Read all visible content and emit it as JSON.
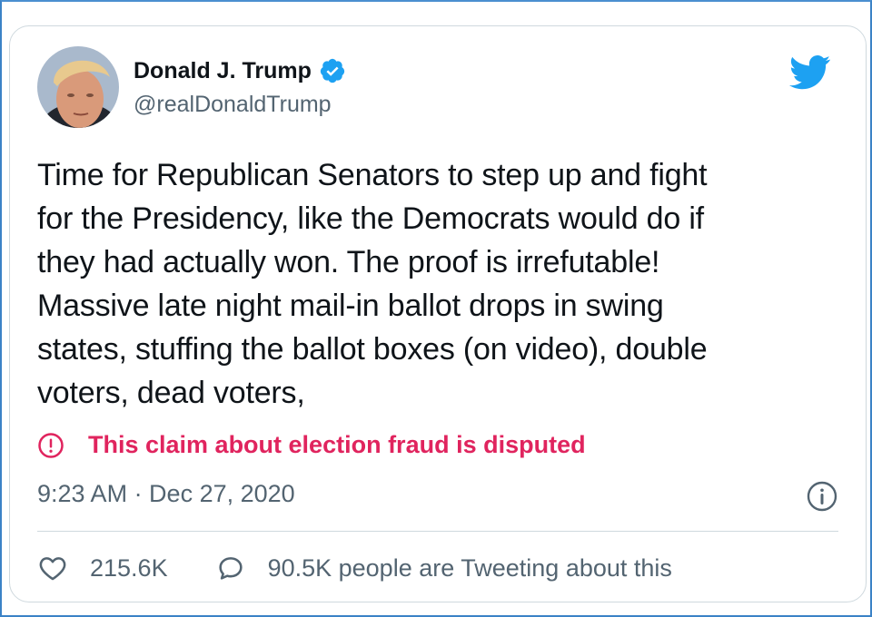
{
  "tweet": {
    "author": {
      "name": "Donald J. Trump",
      "handle": "@realDonaldTrump",
      "verified": true
    },
    "text": "Time for Republican Senators to step up and fight\nfor the Presidency, like the Democrats would do if\nthey had actually won. The proof is irrefutable!\nMassive late night mail-in ballot drops in swing\nstates, stuffing the ballot boxes (on video), double\nvoters, dead voters,",
    "label": {
      "text": "This claim about election fraud is disputed",
      "icon": "alert-circle-icon",
      "color": "#e0245e"
    },
    "timestamp": "9:23 AM · Dec 27, 2020",
    "likes": "215.6K",
    "conversation": "90.5K people are Tweeting about this"
  },
  "icons": {
    "brand": "twitter-bird-icon",
    "verified": "verified-badge-icon",
    "info": "info-icon",
    "like": "heart-icon",
    "reply": "speech-bubble-icon"
  },
  "colors": {
    "twitter_blue": "#1da1f2",
    "disputed_red": "#e0245e",
    "secondary_text": "#536471",
    "primary_text": "#0f1419",
    "border": "#cfd9de"
  }
}
